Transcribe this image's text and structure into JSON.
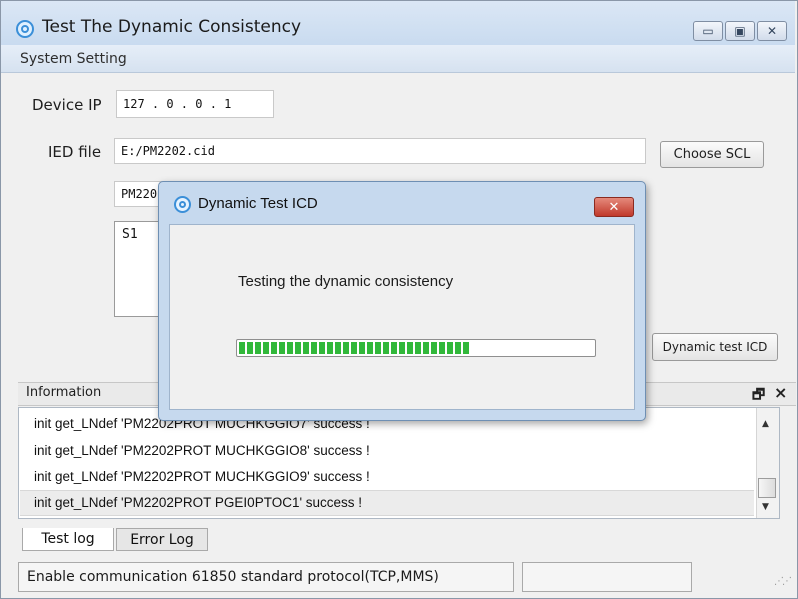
{
  "window": {
    "title": "Test The Dynamic Consistency",
    "menu_item": "System Setting",
    "controls": {
      "minimize": "▭",
      "maximize": "▣",
      "close": "✕"
    }
  },
  "device": {
    "ip_label": "Device IP",
    "ip_value": "127 . 0 . 0 . 1"
  },
  "ied": {
    "file_label": "IED file",
    "file_value": "E:/PM2202.cid",
    "choose_button": "Choose SCL",
    "ied_name_partial": "PM220",
    "list_item": "S1",
    "dynamic_button": "Dynamic test ICD"
  },
  "information": {
    "title": "Information",
    "dock_icon": "🗗",
    "close_icon": "×",
    "log_lines": [
      "init get_LNdef 'PM2202PROT MUCHKGGIO7' success !",
      "init get_LNdef 'PM2202PROT MUCHKGGIO8' success !",
      "init get_LNdef 'PM2202PROT MUCHKGGIO9' success !",
      "init get_LNdef 'PM2202PROT PGEI0PTOC1' success !"
    ]
  },
  "tabs": [
    "Test log",
    "Error Log"
  ],
  "status": {
    "text": "Enable communication 61850 standard protocol(TCP,MMS)",
    "secondary": ""
  },
  "dialog": {
    "title": "Dynamic Test ICD",
    "close": "✕",
    "message": "Testing the dynamic consistency",
    "progress_fraction": 0.65
  },
  "colors": {
    "progress": "#31b83a",
    "dialog_frame": "#c6d9ee",
    "dialog_close": "#c0392b",
    "titlebar": "#c9dbf0"
  }
}
